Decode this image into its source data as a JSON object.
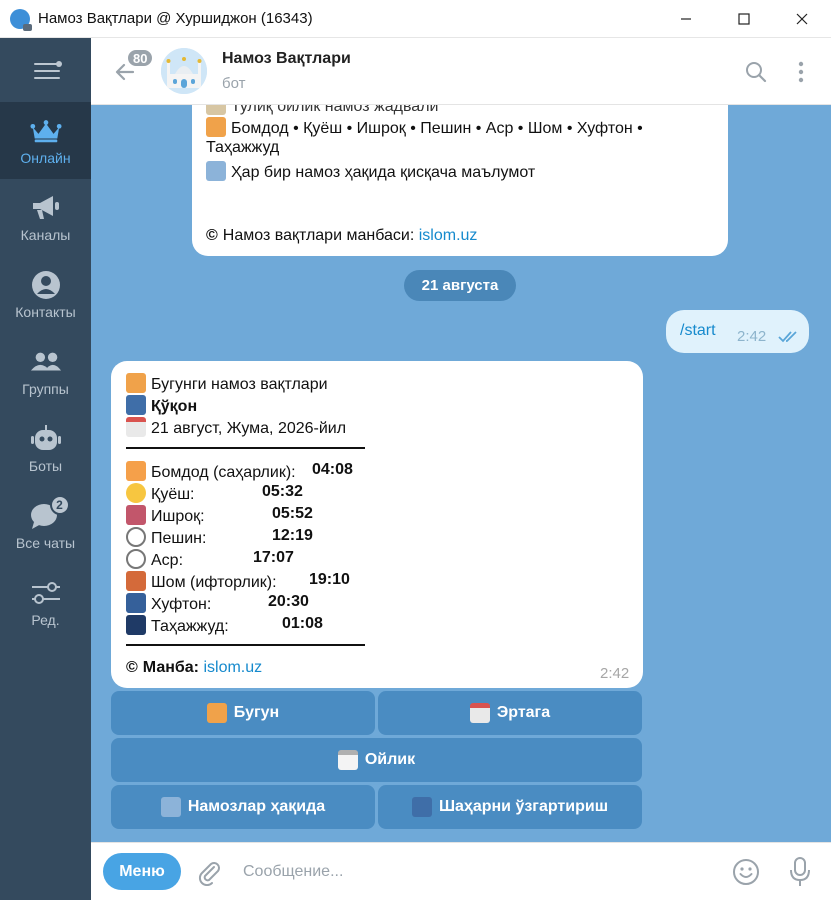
{
  "window": {
    "title": "Намоз Вақтлари @ Хуршиджон (16343)",
    "controls": [
      "minimize",
      "maximize",
      "close"
    ]
  },
  "sidebar": {
    "items": [
      {
        "label": "Онлайн",
        "icon": "crown-icon",
        "active": true
      },
      {
        "label": "Каналы",
        "icon": "megaphone-icon"
      },
      {
        "label": "Контакты",
        "icon": "person-icon"
      },
      {
        "label": "Группы",
        "icon": "group-icon"
      },
      {
        "label": "Боты",
        "icon": "robot-icon"
      },
      {
        "label": "Все чаты",
        "icon": "chats-icon",
        "badge": "2"
      },
      {
        "label": "Ред.",
        "icon": "sliders-icon"
      }
    ]
  },
  "header": {
    "unread": "80",
    "title": "Намоз Вақтлари",
    "subtitle": "бот"
  },
  "prev_message": {
    "line_partial": "Тулиқ ойлик намоз жадвали",
    "line_prayers_1": "Бомдод • Қуёш • Ишроқ • Пешин • Аср • Шом • Хуфтон •",
    "line_prayers_2": "Таҳажжуд",
    "line_info": "Ҳар бир намоз ҳақида қисқача маълумот",
    "source_label": "Намоз вақтлари манбаси:",
    "source_link": "islom.uz"
  },
  "date_separator": "21 августа",
  "outgoing": {
    "text": "/start",
    "time": "2:42"
  },
  "prayer_message": {
    "heading": "Бугунги намоз вақтлари",
    "city": "Қўқон",
    "date": "21 август, Жума, 2026-йил",
    "times": [
      {
        "name": "Бомдод (саҳарлик):",
        "time": "04:08"
      },
      {
        "name": "Қуёш:",
        "time": "05:32"
      },
      {
        "name": "Ишроқ:",
        "time": "05:52"
      },
      {
        "name": "Пешин:",
        "time": "12:19"
      },
      {
        "name": "Аср:",
        "time": "17:07"
      },
      {
        "name": "Шом (ифторлик):",
        "time": "19:10"
      },
      {
        "name": "Хуфтон:",
        "time": "20:30"
      },
      {
        "name": "Таҳажжуд:",
        "time": "01:08"
      }
    ],
    "source_label": "Манба:",
    "source_link": "islom.uz",
    "time": "2:42"
  },
  "keyboard": {
    "today": "Бугун",
    "tomorrow": "Эртага",
    "monthly": "Ойлик",
    "about": "Намозлар ҳақида",
    "change_city": "Шаҳарни ўзгартириш"
  },
  "input_bar": {
    "menu": "Меню",
    "placeholder": "Сообщение..."
  },
  "colors": {
    "chat_bg": "#6fa9d8",
    "sidebar_bg": "#344a5e",
    "accent": "#48a4e4",
    "keyboard_btn": "#4a8cc2",
    "link": "#168acd"
  }
}
